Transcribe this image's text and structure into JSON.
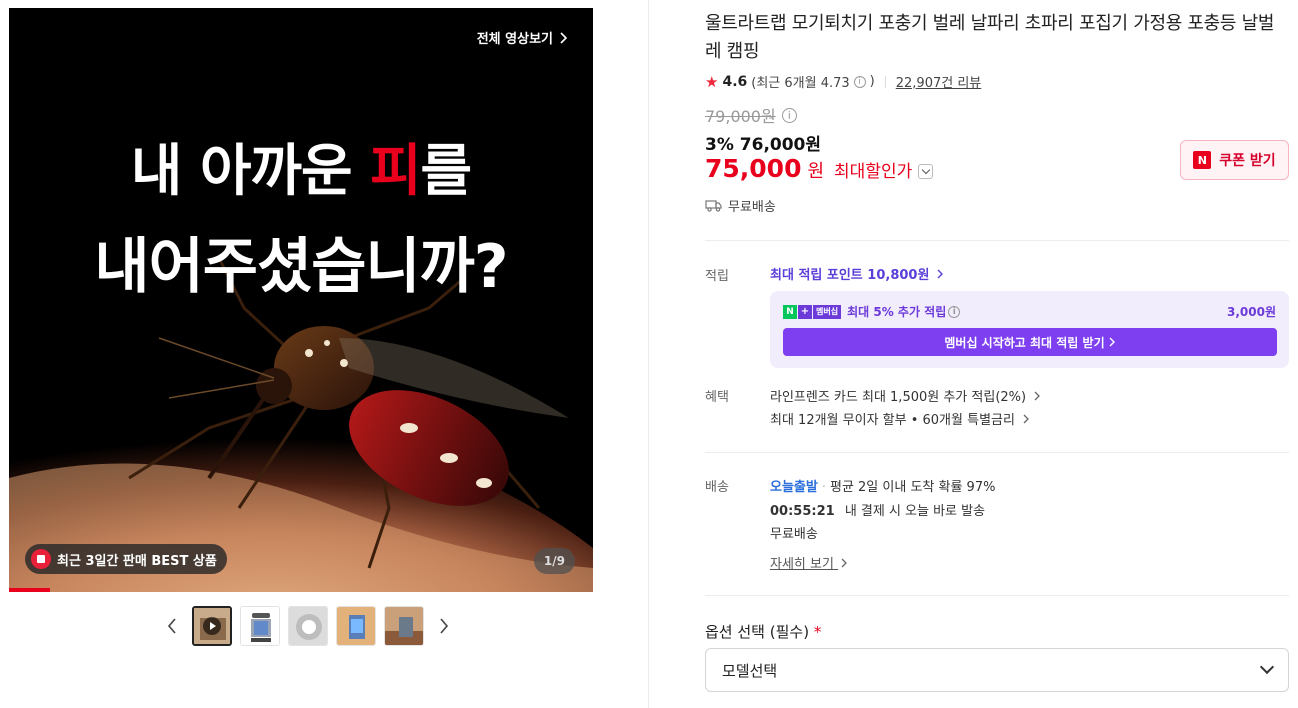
{
  "media": {
    "watch_all": "전체 영상보기",
    "headline_line1_pre": "내 아까운 ",
    "headline_line1_accent": "피",
    "headline_line1_post": "를",
    "headline_line2": "내어주셨습니까?",
    "best_badge": "최근 3일간 판매 BEST 상품",
    "counter": "1/9",
    "progress_fraction": 0.07
  },
  "thumbnails": {
    "count": 5,
    "active_index": 0,
    "items": [
      {
        "icon": "play-icon"
      },
      {
        "icon": "trap-product"
      },
      {
        "icon": "trap-closeup"
      },
      {
        "icon": "trap-lit"
      },
      {
        "icon": "trap-in-use"
      }
    ]
  },
  "product": {
    "title": "울트라트랩 모기퇴치기 포충기 벌레 날파리 초파리 포집기 가정용 포충등 날벌레 캠핑",
    "rating_score": "4.6",
    "rating_recent": "(최근 6개월 4.73",
    "rating_recent_close": ")",
    "reviews": "22,907건 리뷰",
    "original_price": "79,000원",
    "sale_price": "3% 76,000원",
    "max_discount_amount": "75,000",
    "max_discount_won": "원",
    "max_discount_label": "최대할인가",
    "coupon_label": "쿠폰 받기",
    "shipping_free": "무료배송"
  },
  "points": {
    "label": "적립",
    "max_point": "최대 적립 포인트 10,800원",
    "member_text": "최대 5% 추가 적립",
    "member_amount": "3,000원",
    "member_badge": "멤버십",
    "member_button": "멤버십 시작하고 최대 적립 받기"
  },
  "benefits": {
    "label": "혜택",
    "items": [
      "라인프렌즈 카드 최대 1,500원 추가 적립(2%)",
      "최대 12개월 무이자 할부 • 60개월 특별금리"
    ]
  },
  "delivery": {
    "label": "배송",
    "today": "오늘출발",
    "avg": "평균 2일 이내 도착 확률 97%",
    "countdown": "00:55:21",
    "countdown_text": "내 결제 시 오늘 바로 발송",
    "free": "무료배송",
    "detail": "자세히 보기"
  },
  "option": {
    "label": "옵션 선택 (필수)",
    "required_mark": "*",
    "select_value": "모델선택"
  },
  "colors": {
    "accent_red": "#e8001c",
    "membership_purple": "#7d3ff0",
    "today_blue": "#2a6fdb"
  }
}
